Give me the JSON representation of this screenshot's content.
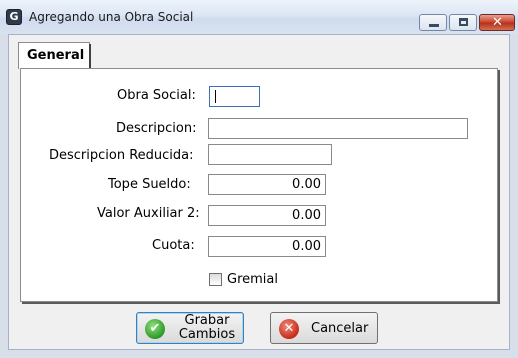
{
  "window": {
    "title": "Agregando una Obra Social",
    "app_icon": "app-logo-icon",
    "controls": {
      "minimize": "minimize-icon",
      "maximize": "maximize-icon",
      "close": "close-icon"
    }
  },
  "tabs": [
    {
      "label": "General",
      "selected": true
    }
  ],
  "form": {
    "obra_social": {
      "label": "Obra Social:",
      "value": ""
    },
    "descripcion": {
      "label": "Descripcion:",
      "value": ""
    },
    "descripcion_reducida": {
      "label": "Descripcion Reducida:",
      "value": ""
    },
    "tope_sueldo": {
      "label": "Tope Sueldo:",
      "value": "0.00"
    },
    "valor_auxiliar_2": {
      "label": "Valor Auxiliar 2:",
      "value": "0.00"
    },
    "cuota": {
      "label": "Cuota:",
      "value": "0.00"
    },
    "gremial": {
      "label": "Gremial",
      "checked": false
    }
  },
  "buttons": {
    "save": {
      "line1": "Grabar",
      "line2": "Cambios",
      "icon": "checkmark-icon"
    },
    "cancel": {
      "label": "Cancelar",
      "icon": "cancel-x-icon"
    }
  },
  "colors": {
    "save_icon": "#2e9a2a",
    "cancel_icon": "#c82a18",
    "titlebar": "#dce6f4"
  }
}
